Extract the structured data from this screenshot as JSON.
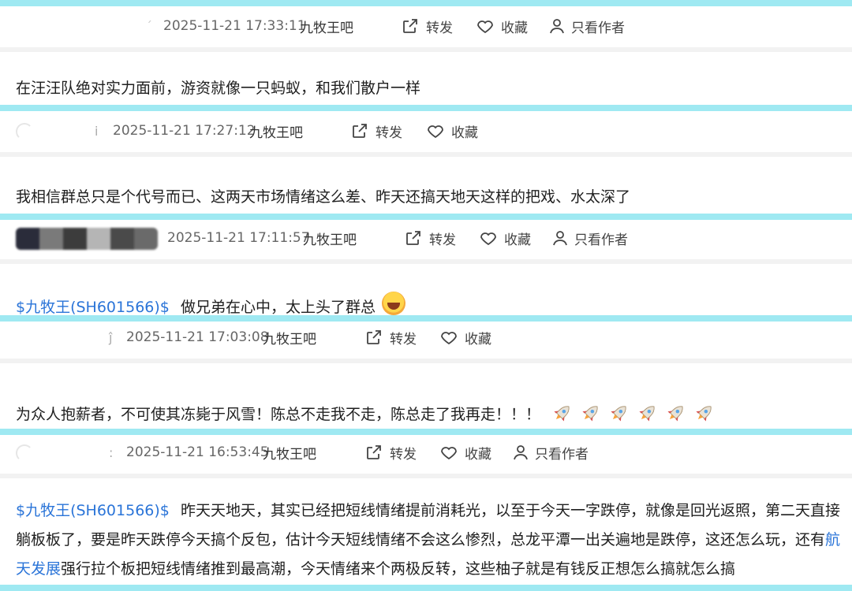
{
  "entries": [
    {
      "timestamp": "2025-11-21 17:33:11",
      "bar": "九牧王吧",
      "forward": "转发",
      "favorite": "收藏",
      "author_only": "只看作者",
      "content": "在汪汪队绝对实力面前，游资就像一只蚂蚁，和我们散户一样"
    },
    {
      "glyph": "ⅰ",
      "timestamp": "2025-11-21 17:27:12",
      "bar": "九牧王吧",
      "forward": "转发",
      "favorite": "收藏",
      "content": "我相信群总只是个代号而已、这两天市场情绪这么差、昨天还搞天地天这样的把戏、水太深了"
    },
    {
      "timestamp": "2025-11-21 17:11:57",
      "bar": "九牧王吧",
      "forward": "转发",
      "favorite": "收藏",
      "author_only": "只看作者",
      "stock_link": "$九牧王(SH601566)$",
      "content": "做兄弟在心中，太上头了群总"
    },
    {
      "glyph": "ĵ",
      "timestamp": "2025-11-21 17:03:08",
      "bar": "九牧王吧",
      "forward": "转发",
      "favorite": "收藏",
      "content": "为众人抱薪者，不可使其冻毙于风雪！陈总不走我不走，陈总走了我再走！！！"
    },
    {
      "glyph": ":",
      "timestamp": "2025-11-21 16:53:45",
      "bar": "九牧王吧",
      "forward": "转发",
      "favorite": "收藏",
      "author_only": "只看作者",
      "stock_link": "$九牧王(SH601566)$",
      "content_a": "昨天天地天，其实已经把短线情绪提前消耗光，以至于今天一字跌停，就像是回光返照，第二天直接躺板板了，要是昨天跌停今天搞个反包，估计今天短线情绪不会这么惨烈，总龙平潭一出关遍地是跌停，这还怎么玩，还有",
      "link": "航天发展",
      "content_b": "强行拉个板把短线情绪推到最高潮，今天情绪来个两极反转，这些柚子就是有钱反正想怎么搞就怎么搞"
    }
  ],
  "icons": {
    "forward": "share-icon",
    "favorite": "heart-icon",
    "author": "person-icon",
    "emoji": "laughing-crying-emoji",
    "rocket": "rocket-emoji"
  },
  "colors": {
    "band": "#9fe9f2",
    "link": "#2a74d8"
  }
}
